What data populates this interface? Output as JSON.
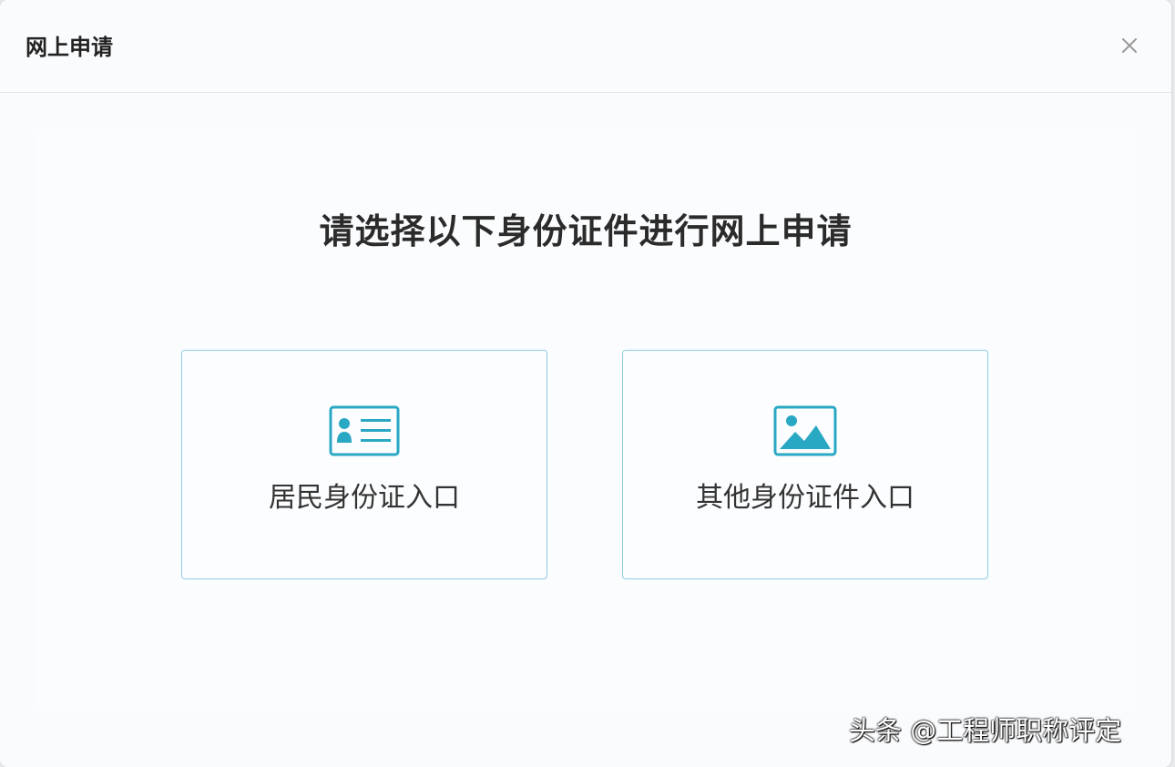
{
  "dialog": {
    "title": "网上申请",
    "close_icon": "close-icon"
  },
  "main": {
    "heading": "请选择以下身份证件进行网上申请",
    "options": [
      {
        "label": "居民身份证入口",
        "icon": "id-card-icon"
      },
      {
        "label": "其他身份证件入口",
        "icon": "image-icon"
      }
    ]
  },
  "watermark": {
    "text": "头条 @工程师职称评定"
  },
  "colors": {
    "accent": "#29a8c4",
    "card_border": "#8fcbe0",
    "title_text": "#222222"
  }
}
